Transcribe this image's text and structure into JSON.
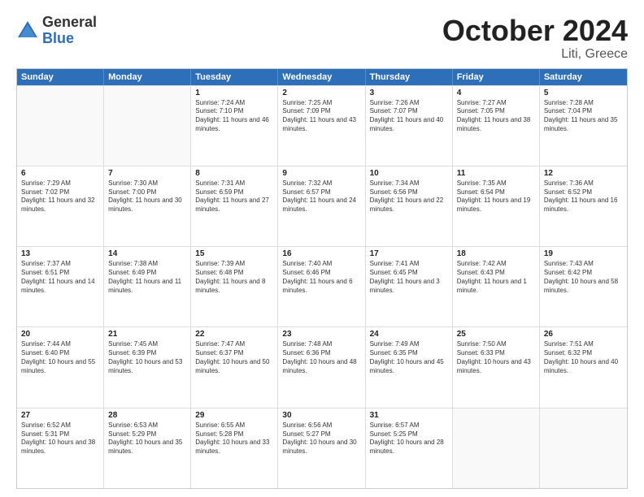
{
  "logo": {
    "general": "General",
    "blue": "Blue"
  },
  "title": "October 2024",
  "subtitle": "Liti, Greece",
  "days": [
    "Sunday",
    "Monday",
    "Tuesday",
    "Wednesday",
    "Thursday",
    "Friday",
    "Saturday"
  ],
  "weeks": [
    [
      {
        "day": "",
        "empty": true
      },
      {
        "day": "",
        "empty": true
      },
      {
        "day": "1",
        "sun": "Sunrise: 7:24 AM",
        "set": "Sunset: 7:10 PM",
        "day_text": "Daylight: 11 hours and 46 minutes."
      },
      {
        "day": "2",
        "sun": "Sunrise: 7:25 AM",
        "set": "Sunset: 7:09 PM",
        "day_text": "Daylight: 11 hours and 43 minutes."
      },
      {
        "day": "3",
        "sun": "Sunrise: 7:26 AM",
        "set": "Sunset: 7:07 PM",
        "day_text": "Daylight: 11 hours and 40 minutes."
      },
      {
        "day": "4",
        "sun": "Sunrise: 7:27 AM",
        "set": "Sunset: 7:05 PM",
        "day_text": "Daylight: 11 hours and 38 minutes."
      },
      {
        "day": "5",
        "sun": "Sunrise: 7:28 AM",
        "set": "Sunset: 7:04 PM",
        "day_text": "Daylight: 11 hours and 35 minutes."
      }
    ],
    [
      {
        "day": "6",
        "sun": "Sunrise: 7:29 AM",
        "set": "Sunset: 7:02 PM",
        "day_text": "Daylight: 11 hours and 32 minutes."
      },
      {
        "day": "7",
        "sun": "Sunrise: 7:30 AM",
        "set": "Sunset: 7:00 PM",
        "day_text": "Daylight: 11 hours and 30 minutes."
      },
      {
        "day": "8",
        "sun": "Sunrise: 7:31 AM",
        "set": "Sunset: 6:59 PM",
        "day_text": "Daylight: 11 hours and 27 minutes."
      },
      {
        "day": "9",
        "sun": "Sunrise: 7:32 AM",
        "set": "Sunset: 6:57 PM",
        "day_text": "Daylight: 11 hours and 24 minutes."
      },
      {
        "day": "10",
        "sun": "Sunrise: 7:34 AM",
        "set": "Sunset: 6:56 PM",
        "day_text": "Daylight: 11 hours and 22 minutes."
      },
      {
        "day": "11",
        "sun": "Sunrise: 7:35 AM",
        "set": "Sunset: 6:54 PM",
        "day_text": "Daylight: 11 hours and 19 minutes."
      },
      {
        "day": "12",
        "sun": "Sunrise: 7:36 AM",
        "set": "Sunset: 6:52 PM",
        "day_text": "Daylight: 11 hours and 16 minutes."
      }
    ],
    [
      {
        "day": "13",
        "sun": "Sunrise: 7:37 AM",
        "set": "Sunset: 6:51 PM",
        "day_text": "Daylight: 11 hours and 14 minutes."
      },
      {
        "day": "14",
        "sun": "Sunrise: 7:38 AM",
        "set": "Sunset: 6:49 PM",
        "day_text": "Daylight: 11 hours and 11 minutes."
      },
      {
        "day": "15",
        "sun": "Sunrise: 7:39 AM",
        "set": "Sunset: 6:48 PM",
        "day_text": "Daylight: 11 hours and 8 minutes."
      },
      {
        "day": "16",
        "sun": "Sunrise: 7:40 AM",
        "set": "Sunset: 6:46 PM",
        "day_text": "Daylight: 11 hours and 6 minutes."
      },
      {
        "day": "17",
        "sun": "Sunrise: 7:41 AM",
        "set": "Sunset: 6:45 PM",
        "day_text": "Daylight: 11 hours and 3 minutes."
      },
      {
        "day": "18",
        "sun": "Sunrise: 7:42 AM",
        "set": "Sunset: 6:43 PM",
        "day_text": "Daylight: 11 hours and 1 minute."
      },
      {
        "day": "19",
        "sun": "Sunrise: 7:43 AM",
        "set": "Sunset: 6:42 PM",
        "day_text": "Daylight: 10 hours and 58 minutes."
      }
    ],
    [
      {
        "day": "20",
        "sun": "Sunrise: 7:44 AM",
        "set": "Sunset: 6:40 PM",
        "day_text": "Daylight: 10 hours and 55 minutes."
      },
      {
        "day": "21",
        "sun": "Sunrise: 7:45 AM",
        "set": "Sunset: 6:39 PM",
        "day_text": "Daylight: 10 hours and 53 minutes."
      },
      {
        "day": "22",
        "sun": "Sunrise: 7:47 AM",
        "set": "Sunset: 6:37 PM",
        "day_text": "Daylight: 10 hours and 50 minutes."
      },
      {
        "day": "23",
        "sun": "Sunrise: 7:48 AM",
        "set": "Sunset: 6:36 PM",
        "day_text": "Daylight: 10 hours and 48 minutes."
      },
      {
        "day": "24",
        "sun": "Sunrise: 7:49 AM",
        "set": "Sunset: 6:35 PM",
        "day_text": "Daylight: 10 hours and 45 minutes."
      },
      {
        "day": "25",
        "sun": "Sunrise: 7:50 AM",
        "set": "Sunset: 6:33 PM",
        "day_text": "Daylight: 10 hours and 43 minutes."
      },
      {
        "day": "26",
        "sun": "Sunrise: 7:51 AM",
        "set": "Sunset: 6:32 PM",
        "day_text": "Daylight: 10 hours and 40 minutes."
      }
    ],
    [
      {
        "day": "27",
        "sun": "Sunrise: 6:52 AM",
        "set": "Sunset: 5:31 PM",
        "day_text": "Daylight: 10 hours and 38 minutes."
      },
      {
        "day": "28",
        "sun": "Sunrise: 6:53 AM",
        "set": "Sunset: 5:29 PM",
        "day_text": "Daylight: 10 hours and 35 minutes."
      },
      {
        "day": "29",
        "sun": "Sunrise: 6:55 AM",
        "set": "Sunset: 5:28 PM",
        "day_text": "Daylight: 10 hours and 33 minutes."
      },
      {
        "day": "30",
        "sun": "Sunrise: 6:56 AM",
        "set": "Sunset: 5:27 PM",
        "day_text": "Daylight: 10 hours and 30 minutes."
      },
      {
        "day": "31",
        "sun": "Sunrise: 6:57 AM",
        "set": "Sunset: 5:25 PM",
        "day_text": "Daylight: 10 hours and 28 minutes."
      },
      {
        "day": "",
        "empty": true
      },
      {
        "day": "",
        "empty": true
      }
    ]
  ]
}
